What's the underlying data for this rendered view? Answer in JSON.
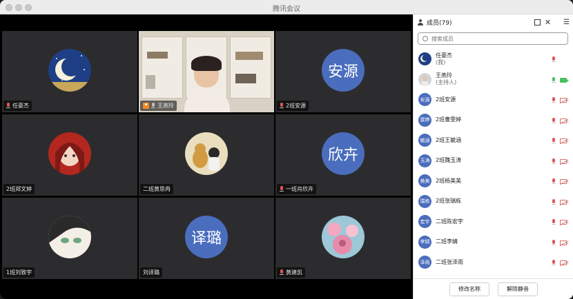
{
  "window": {
    "title": "腾讯会议"
  },
  "tiles": [
    {
      "name": "任豪杰",
      "type": "image",
      "avatar": "moon-icon",
      "muted": true
    },
    {
      "name": "王燕玲",
      "type": "video",
      "host": true,
      "muted": false
    },
    {
      "name": "2班安源",
      "type": "text",
      "avatar_text": "安源",
      "muted": true
    },
    {
      "name": "2班郑文婷",
      "type": "image",
      "avatar": "girl-portrait-icon"
    },
    {
      "name": "二班黄思冉",
      "type": "image",
      "avatar": "cartoon-dog-icon"
    },
    {
      "name": "一班肖欣卉",
      "type": "text",
      "avatar_text": "欣卉",
      "muted": true
    },
    {
      "name": "1班刘致宇",
      "type": "image",
      "avatar": "anime-face-icon"
    },
    {
      "name": "刘译璐",
      "type": "text",
      "avatar_text": "译璐"
    },
    {
      "name": "黄建凯",
      "type": "image",
      "avatar": "pink-flowers-icon",
      "muted": true
    }
  ],
  "panel": {
    "title": "成员(79)",
    "search_placeholder": "搜索成员",
    "members": [
      {
        "name": "任豪杰",
        "sub": "(我)",
        "avatar": "moon-icon",
        "mic": "muted",
        "cam": "none"
      },
      {
        "name": "王燕玲",
        "sub": "(主持人)",
        "avatar": "photo",
        "mic": "on",
        "cam": "on"
      },
      {
        "name": "2班安源",
        "avatar_text": "安源",
        "mic": "muted",
        "cam": "off"
      },
      {
        "name": "2班曹雯婷",
        "avatar_text": "雯婷",
        "mic": "muted",
        "cam": "off"
      },
      {
        "name": "2班王毓涵",
        "avatar_text": "毓涵",
        "mic": "muted",
        "cam": "off"
      },
      {
        "name": "2班魏玉涛",
        "avatar_text": "玉涛",
        "mic": "muted",
        "cam": "off"
      },
      {
        "name": "2班杨美美",
        "avatar_text": "美美",
        "mic": "muted",
        "cam": "off"
      },
      {
        "name": "2班张瑞栋",
        "avatar_text": "瑞栋",
        "mic": "muted",
        "cam": "off"
      },
      {
        "name": "二班陈宏宇",
        "avatar_text": "宏宇",
        "mic": "muted",
        "cam": "off"
      },
      {
        "name": "二班李婧",
        "avatar_text": "李婧",
        "mic": "muted",
        "cam": "off"
      },
      {
        "name": "二班张泽雨",
        "avatar_text": "泽雨",
        "mic": "muted",
        "cam": "off"
      }
    ],
    "rename_button": "修改名称",
    "unmute_button": "解除静音"
  },
  "colors": {
    "accent": "#4a6dbd",
    "active": "#2fbf5b",
    "host": "#f08a24"
  }
}
